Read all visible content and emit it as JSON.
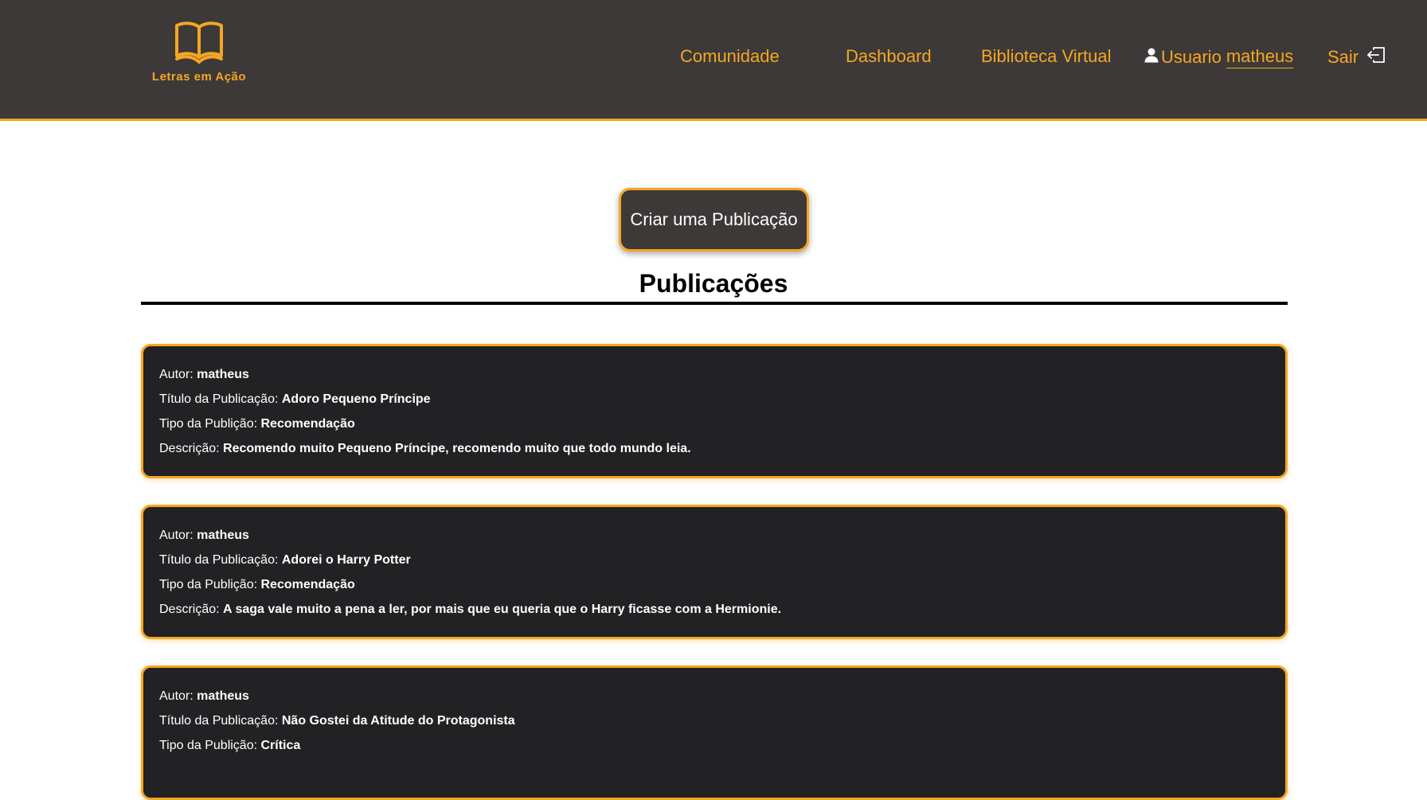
{
  "brand": {
    "name": "Letras em Ação",
    "accent_color": "#f5a623",
    "navbar_color": "#3d3938",
    "logo_icon": "open-book-icon"
  },
  "nav": {
    "comunidade": "Comunidade",
    "dashboard": "Dashboard",
    "biblioteca": "Biblioteca Virtual",
    "user_prefix": "Usuario",
    "username": "matheus",
    "user_icon": "user-icon",
    "logout": "Sair",
    "logout_icon": "logout-icon"
  },
  "main": {
    "create_button": "Criar uma Publicação",
    "section_title": "Publicações"
  },
  "labels": {
    "autor": "Autor: ",
    "titulo": "Título da Publicação: ",
    "tipo": "Tipo da Publição: ",
    "descricao": "Descrição: "
  },
  "posts": [
    {
      "autor": "matheus",
      "titulo": "Adoro Pequeno Príncipe",
      "tipo": "Recomendação",
      "descricao": "Recomendo muito Pequeno Príncipe, recomendo muito que todo mundo leia."
    },
    {
      "autor": "matheus",
      "titulo": "Adorei o Harry Potter",
      "tipo": "Recomendação",
      "descricao": "A saga vale muito a pena a ler, por mais que eu queria que o Harry ficasse com a Hermionie."
    },
    {
      "autor": "matheus",
      "titulo": "Não Gostei da Atitude do Protagonista",
      "tipo": "Crítica"
    }
  ]
}
